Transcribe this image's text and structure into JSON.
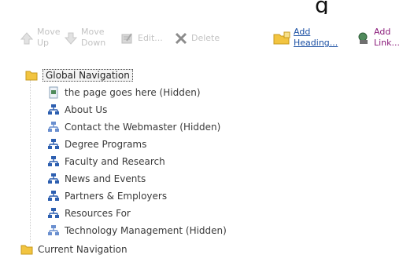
{
  "header": {
    "title_fragment": "g"
  },
  "toolbar": {
    "move_up": "Move\nUp",
    "move_down": "Move\nDown",
    "edit": "Edit...",
    "delete": "Delete",
    "add_heading": "Add\nHeading...",
    "add_link": "Add\nLink..."
  },
  "tree": {
    "nodes": [
      {
        "label": "Global Navigation",
        "icon": "folder-icon",
        "level": 0,
        "selected": true
      },
      {
        "label": "the page goes here (Hidden)",
        "icon": "page-icon",
        "level": 1
      },
      {
        "label": "About Us",
        "icon": "sitemap-icon",
        "level": 1
      },
      {
        "label": "Contact the Webmaster (Hidden)",
        "icon": "sitemap-icon",
        "level": 1
      },
      {
        "label": "Degree Programs",
        "icon": "sitemap-icon",
        "level": 1
      },
      {
        "label": "Faculty and Research",
        "icon": "sitemap-icon",
        "level": 1
      },
      {
        "label": "News and Events",
        "icon": "sitemap-icon",
        "level": 1
      },
      {
        "label": "Partners & Employers",
        "icon": "sitemap-icon",
        "level": 1
      },
      {
        "label": "Resources For",
        "icon": "sitemap-icon",
        "level": 1
      },
      {
        "label": "Technology Management (Hidden)",
        "icon": "sitemap-icon",
        "level": 1
      },
      {
        "label": "Current Navigation",
        "icon": "folder-icon",
        "level": 0
      }
    ]
  },
  "colors": {
    "disabled_text": "#c3c3c3",
    "link_blue": "#1a4fa3",
    "link_purple": "#8a1a7a",
    "tree_text": "#3a3a3a",
    "folder_yellow": "#f2c440",
    "sitemap_blue": "#2d5fb0"
  }
}
